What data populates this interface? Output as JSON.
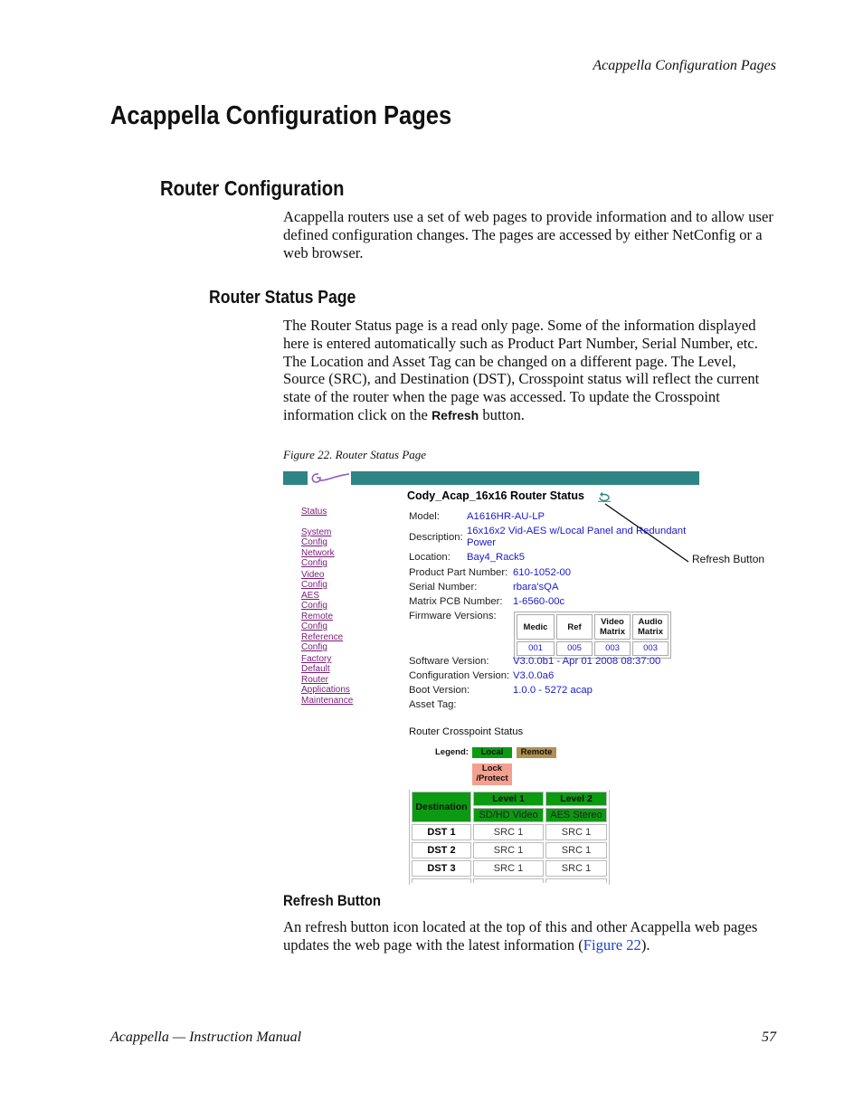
{
  "running_head": "Acappella Configuration Pages",
  "page_title": "Acappella Configuration Pages",
  "section": {
    "title": "Router Configuration",
    "intro": "Acappella routers use a set of web pages to provide information and to allow user defined configuration changes. The pages are accessed by either NetConfig or a web browser."
  },
  "subsection": {
    "title": "Router Status Page",
    "body_before": "The Router Status page is a read only page. Some of the information displayed here is entered automatically such as Product Part Number, Serial Number, etc. The Location and Asset Tag can be changed on a different page. The Level, Source (SRC), and Destination (DST), Crosspoint status will reflect the current state of the router when the page was accessed. To update the Crosspoint information click on the",
    "body_ui_ref": "Refresh",
    "body_after": "button."
  },
  "figure": {
    "caption": "Figure 22.  Router Status Page",
    "callout": "Refresh Button",
    "colors": {
      "banner": "#2e8585",
      "local": "#0b9a12",
      "remote": "#b09050",
      "lock": "#f4a090",
      "link": "#7a1a7a",
      "value": "#1a1ad0"
    },
    "nav": [
      "Status",
      "System Config",
      "Network Config",
      "Video Config",
      "AES Config",
      "Remote Config",
      "Reference Config",
      "Factory Default",
      "Router Applications",
      "Maintenance"
    ],
    "title": "Cody_Acap_16x16 Router Status",
    "refresh_icon": "refresh-icon",
    "info": {
      "model_label": "Model:",
      "model": "A1616HR-AU-LP",
      "description_label": "Description:",
      "description_line1": "16x16x2 Vid-AES w/Local Panel and Redundant",
      "description_line2": "Power",
      "location_label": "Location:",
      "location": "Bay4_Rack5",
      "part_label": "Product Part Number:",
      "part": "610-1052-00",
      "serial_label": "Serial Number:",
      "serial": "rbara'sQA",
      "pcb_label": "Matrix PCB Number:",
      "pcb": "1-6560-00c",
      "firmware_label": "Firmware Versions:",
      "software_label": "Software Version:",
      "software": "V3.0.0b1 - Apr 01 2008 08:37:00",
      "config_label": "Configuration Version:",
      "config": "V3.0.0a6",
      "boot_label": "Boot Version:",
      "boot": "1.0.0 - 5272 acap",
      "asset_label": "Asset Tag:"
    },
    "firmware": {
      "headers": [
        "Medic",
        "Ref",
        "Video Matrix",
        "Audio Matrix"
      ],
      "values": [
        "001",
        "005",
        "003",
        "003"
      ]
    },
    "crosspoint": {
      "title": "Router Crosspoint Status",
      "legend_label": "Legend:",
      "legend": [
        "Local",
        "Remote",
        "Lock /Protect"
      ],
      "dest_header": "Destination",
      "levels": [
        {
          "name": "Level 1",
          "type": "SD/HD Video"
        },
        {
          "name": "Level 2",
          "type": "AES Stereo"
        }
      ],
      "rows": [
        {
          "dst": "DST 1",
          "srcs": [
            "SRC 1",
            "SRC 1"
          ]
        },
        {
          "dst": "DST 2",
          "srcs": [
            "SRC 1",
            "SRC 1"
          ]
        },
        {
          "dst": "DST 3",
          "srcs": [
            "SRC 1",
            "SRC 1"
          ]
        }
      ]
    }
  },
  "refresh_section": {
    "title": "Refresh Button",
    "body_before": "An refresh button icon located at the top of this and other Acappella web pages updates the web page with the latest information (",
    "link": "Figure 22",
    "body_after": ")."
  },
  "footer": {
    "left": "Acappella  —  Instruction Manual",
    "page_number": "57"
  }
}
